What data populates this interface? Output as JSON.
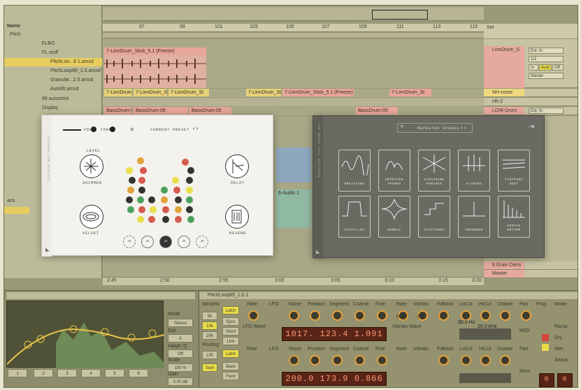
{
  "browser": {
    "header": "Name",
    "items": [
      {
        "label": "Pitch"
      },
      {
        "label": "FLBO"
      },
      {
        "label": "FL stuff"
      },
      {
        "label": "PitchLoo...8 1.amxd"
      },
      {
        "label": "PitchLoop89_1.0.amxd"
      },
      {
        "label": "Granular...2.0.amxd"
      },
      {
        "label": "Autofilt.amxd"
      },
      {
        "label": "99 autosetst"
      },
      {
        "label": "Display"
      },
      {
        "label": "arts"
      }
    ]
  },
  "arrangement": {
    "bar_numbers": [
      "97",
      "99",
      "101",
      "103",
      "105",
      "107",
      "109",
      "111",
      "113",
      "115"
    ],
    "time_markers": [
      "2:45",
      "2:50",
      "2:55",
      "3:00",
      "3:05",
      "3:10",
      "3:15",
      "3:20"
    ],
    "set_label": "Set",
    "clips_top": "7-LinnDrum_Stick_5.1 (Freeze)",
    "clip_short": "7-LinnDrum_St",
    "clip_long": "7-LinnDrum_Stick_5.1 (Freeze)",
    "clip_bass": "BassDrum-09",
    "clip_bass_alt": "BassDrum-05",
    "clip_audio": "6-Audio 1",
    "tracks": [
      {
        "name": "LinnDrum_S",
        "route1": "Ext. In",
        "route2": "1/2",
        "mode1": "In",
        "mode2": "Auto",
        "mode3": "Off",
        "out": "Master"
      },
      {
        "name": "NH-noise"
      },
      {
        "name": "Hh-2"
      },
      {
        "name": "LOW-Drum",
        "route1": "Ext. In"
      },
      {
        "name": "8 Grain Dens"
      },
      {
        "name": "Master"
      }
    ]
  },
  "pluginLeft": {
    "vol_label": "VOL",
    "tone_label": "TONE",
    "preset": "CURRENT PRESET",
    "sidebar_text": "VOLUMEN POR EFECTOS",
    "labels": {
      "shimmer": "SHIMMER",
      "delay": "DELAY",
      "velvet": "VELVET",
      "reverb": "REVERB",
      "top": "LEVEL"
    },
    "bottom_buttons": [
      "4X",
      "2X",
      "1X",
      "2X",
      "4X"
    ]
  },
  "pluginRight": {
    "sidebar_text": "THE GRAIN CELL SETTINGS",
    "preset": "REPEATED SPARKS",
    "tiles": [
      "BREATHING",
      "REPEATED\nSPARKS",
      "CASCADING\nPHRASES",
      "FLARING",
      "FLOATING\nDUST",
      "DISTILLER",
      "WOBBLE",
      "SCATTERED",
      "GROUNDED",
      "GENTLE\nRHYTHM"
    ]
  },
  "rack": {
    "eq": {
      "values": [
        "1",
        "2",
        "3",
        "4",
        "5",
        "6"
      ],
      "mode_label": "Mode",
      "mode_value": "Stereo",
      "edit_label": "Edit",
      "channel": "A",
      "adapt_label": "Adapt. Q",
      "adapt_value": "Off",
      "scale_label": "Scale",
      "scale_value": "100 %",
      "gain_label": "Gain",
      "gain_value": "0.00 dB"
    },
    "pitchloop": {
      "title": "PitchLoop89_1.0.1",
      "window_label": "Window",
      "window_values": [
        "5k",
        "10k",
        "20k"
      ],
      "routing_label": "Routing",
      "routing_values": [
        "L/R",
        "Sum"
      ],
      "latch_labels": [
        "Latch",
        "Latch"
      ],
      "sync_labels": [
        "Sync",
        "Short",
        "Link",
        "Back",
        "Fwrd"
      ],
      "params_row1": [
        "Rate",
        "LFO",
        "Noise",
        "Position",
        "Segment",
        "Coarse",
        "Fine",
        "Rate",
        "Vibrato",
        "FdBack",
        "LoCut",
        "HiCut",
        "Octave",
        "Pan"
      ],
      "params_row2": [
        "Rate",
        "LFO",
        "Noise",
        "Position",
        "Segment",
        "Coarse",
        "Fine",
        "Rate",
        "Vibrato",
        "FdBack",
        "LoCut",
        "HiCut",
        "Octave",
        "Pan"
      ],
      "lfo_wave_label": "LFO Wave",
      "vibrato_wave_label": "Vibrato Wave",
      "display_top": "1017.  123.4  1.091",
      "display_bottom": "200.0  173.9  0.866",
      "vib_values": [
        "0.20",
        "0.2"
      ],
      "fb_values": [
        "50.0 Hz",
        "20.0 kHz"
      ],
      "right_labels": [
        "Ping",
        "Mode",
        "Ramp",
        "Dry",
        "Wet",
        "Attack",
        "Attack"
      ],
      "mode_values": [
        "MIDI",
        "Mem"
      ],
      "zero_values": [
        "0",
        "0"
      ]
    }
  }
}
